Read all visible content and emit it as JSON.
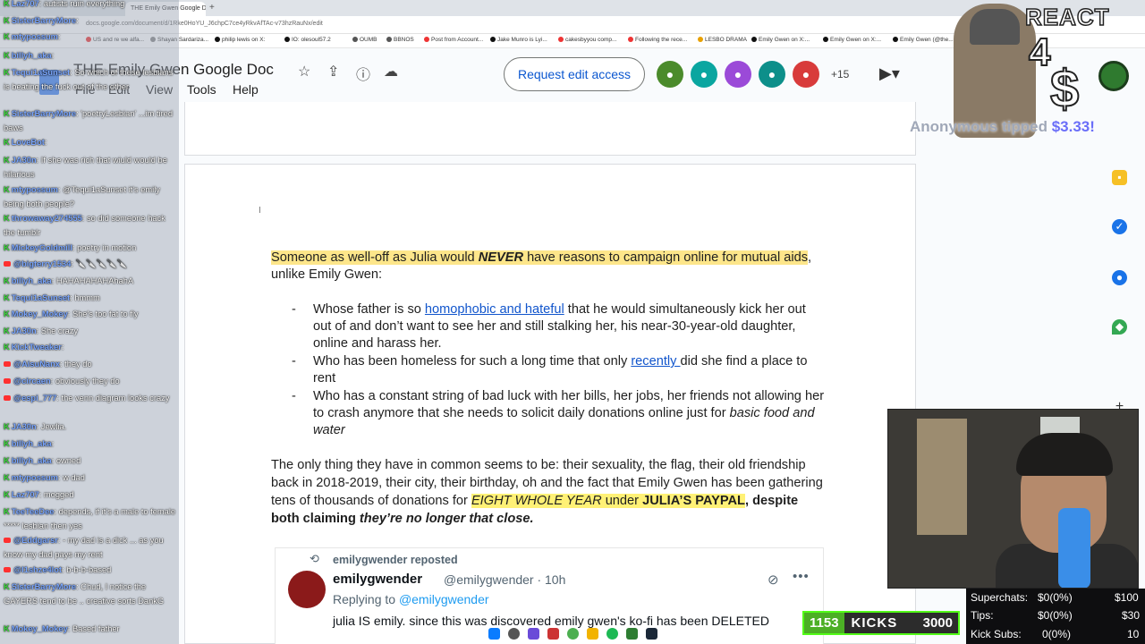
{
  "browser": {
    "active_tab": "THE Emily Gwen Google Doc",
    "new_tab": "+",
    "url": "docs.google.com/document/d/1Rke0HoYU_J6chpC7ce4yRkvAfTAc-v73hzRauNx/edit",
    "bookmarks": [
      "US and re we alfa...",
      "Shayan Sardariza...",
      "philip lewis on X:",
      "IO: olesoul57.2",
      "OUMB",
      "BBNOS",
      "Post from Account...",
      "Jake Munro is Lyi...",
      "cakesbyyou comp...",
      "Following the rece...",
      "LESBO DRAMA",
      "Emily Gwen on X:...",
      "Emily Gwen on X:...",
      "Emily Gwen (@the..."
    ]
  },
  "docs": {
    "title": "THE Emily Gwen Google Doc",
    "menu": [
      "File",
      "Edit",
      "View",
      "Tools",
      "Help"
    ],
    "request_button": "Request edit access",
    "collaborators_more": "+15",
    "icons": [
      "star-icon",
      "move-icon",
      "info-icon",
      "cloud-icon",
      "video-icon"
    ]
  },
  "document": {
    "p1_hl_a": "Someone as well-off as Julia would ",
    "p1_never": "NEVER",
    "p1_hl_b": " have reasons to campaign online for mutual aids",
    "p1_tail": ",",
    "p1_line2": "unlike Emily Gwen:",
    "bullet_dash": "-",
    "b1_a": "Whose father is so ",
    "b1_link": "homophobic and hateful",
    "b1_b": " that he would simultaneously kick her out",
    "b1_l2": "out of and don’t want to see her and still stalking her, his near-30-year-old daughter,",
    "b1_l3": "online and harass her.",
    "b2_a": "Who has been homeless for such a long time that only ",
    "b2_link": "recently ",
    "b2_b": "did she find a place to",
    "b2_l2": "rent",
    "b3_l1": "Who has a constant string of bad luck with her bills, her jobs, her friends not allowing her",
    "b3_l2a": "to crash anymore that she needs to solicit daily donations online just for ",
    "b3_l2b": "basic food and",
    "b3_l3": "water",
    "p2_l1": "The only thing they have in common seems to be: their sexuality, the flag, their old friendship",
    "p2_l2": "back in 2018-2019, their city, their birthday, oh and the fact that Emily Gwen has been gathering",
    "p2_l3a": "tens of thousands of donations for ",
    "p2_l3b": "EIGHT WHOLE YEAR",
    "p2_l3c": " under ",
    "p2_l3d": "JULIA’S PAYPAL",
    "p2_l3e": ", despite",
    "p2_l4a": "both claiming ",
    "p2_l4b": "they’re no longer that close."
  },
  "tweet": {
    "reposted_by": "emilygwender reposted",
    "name": "emilygwender",
    "handle": "@emilygwender · 10h",
    "replying_label": "Replying to ",
    "replying_to": "@emilygwender",
    "body": "julia IS emily. since this was discovered emily gwen's ko-fi has been DELETED"
  },
  "chat": [
    {
      "platform": "kick",
      "user": "Laz707",
      "text": "autists ruin everything"
    },
    {
      "platform": "kick",
      "user": "SisterBarryMore",
      "text": ""
    },
    {
      "platform": "kick",
      "user": "mtypossum",
      "text": ""
    },
    {
      "platform": "kick",
      "user": "billyh_aka",
      "text": ""
    },
    {
      "platform": "kick",
      "user": "Tequi1aSunset",
      "text": "So which of these lesbians is beating the fuck out of the other"
    },
    {
      "platform": "kick",
      "user": "SisterBarryMore",
      "text": "'poetryLesbian' ...im tired baws"
    },
    {
      "platform": "kick",
      "user": "LoveBot",
      "text": ""
    },
    {
      "platform": "kick",
      "user": "JA30n",
      "text": "If she was rich that wiuld would be hilarious"
    },
    {
      "platform": "kick",
      "user": "mtypossum",
      "text": "@Tequi1aSunset it's emily being both people?"
    },
    {
      "platform": "kick",
      "user": "throwaway274555",
      "text": "so did someone hack the tumblr"
    },
    {
      "platform": "kick",
      "user": "MickeyGoldmill",
      "text": "poetry in motion"
    },
    {
      "platform": "yt",
      "user": "@bigterry1534",
      "text": "🔪🔪🔪🔪🔪"
    },
    {
      "platform": "kick",
      "user": "billyh_aka",
      "text": "HAHAHAHAHAhahA"
    },
    {
      "platform": "kick",
      "user": "Tequi1aSunset",
      "text": "hmmm"
    },
    {
      "platform": "kick",
      "user": "Mokey_Mokey",
      "text": "She's too fat to fly"
    },
    {
      "platform": "kick",
      "user": "JA30n",
      "text": "She crazy"
    },
    {
      "platform": "kick",
      "user": "KickTweaker",
      "text": ""
    },
    {
      "platform": "yt",
      "user": "@AisuNanx",
      "text": "they do"
    },
    {
      "platform": "yt",
      "user": "@circaen",
      "text": "obviously they do"
    },
    {
      "platform": "yt",
      "user": "@espi_777",
      "text": "the venn diagram looks crazy"
    },
    {
      "platform": "kick",
      "user": "JA30n",
      "text": "Jewlia."
    },
    {
      "platform": "kick",
      "user": "billyh_aka",
      "text": ""
    },
    {
      "platform": "kick",
      "user": "billyh_aka",
      "text": "owned"
    },
    {
      "platform": "kick",
      "user": "mtypossum",
      "text": "w dad"
    },
    {
      "platform": "kick",
      "user": "Laz707",
      "text": "mogged"
    },
    {
      "platform": "kick",
      "user": "TeeTeeDee",
      "text": "depends, if it's a male to female ***** lesbian then yes"
    },
    {
      "platform": "yt",
      "user": "@Eddgarsr",
      "text": "- my dad is a dick ... as you know my dad pays my rent"
    },
    {
      "platform": "yt",
      "user": "@l1shze4lot",
      "text": "b-b-b-based"
    },
    {
      "platform": "kick",
      "user": "SisterBarryMore",
      "text": "Chud, I notice the GAYERS tend to be .. creative sorts DankG"
    },
    {
      "platform": "kick",
      "user": "Mokey_Mokey",
      "text": "Based father"
    }
  ],
  "overlay": {
    "react_title": "REACT",
    "react_number": "4",
    "react_currency": "$",
    "tip_user": "Anonymous",
    "tip_verb": " tipped ",
    "tip_amount": "$3.33!",
    "kicks_count": "1153",
    "kicks_label": "KICKS",
    "kicks_goal": "3000",
    "stats": [
      {
        "label": "Superchats:",
        "value": "$0(0%)",
        "goal": "$100"
      },
      {
        "label": "Tips:",
        "value": "$0(0%)",
        "goal": "$30"
      },
      {
        "label": "Kick Subs:",
        "value": "0(0%)",
        "goal": "10"
      }
    ]
  }
}
